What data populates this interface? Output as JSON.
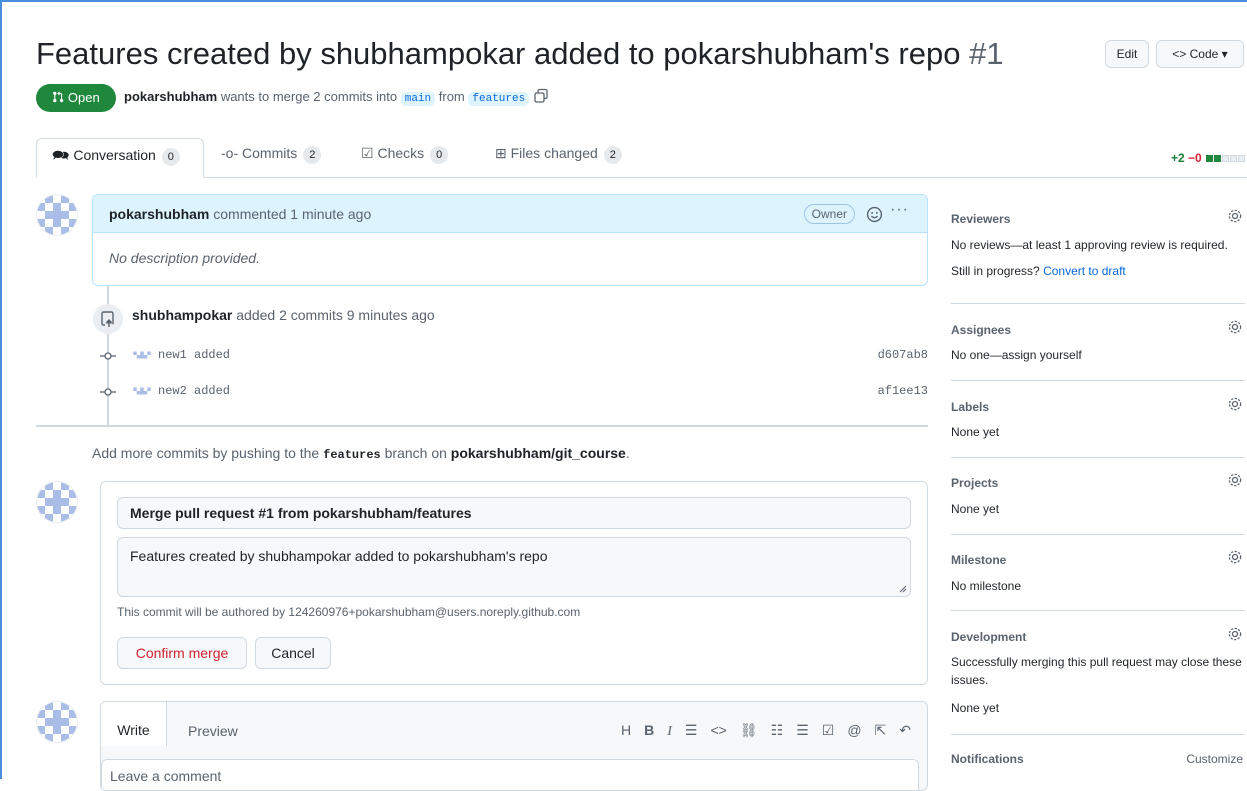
{
  "pr": {
    "title": "Features created by shubhampokar added to pokarshubham's repo",
    "number": "#1",
    "state": "Open",
    "author": "pokarshubham",
    "meta_text": "wants to merge 2 commits into",
    "base_branch": "main",
    "from_text": "from",
    "head_branch": "features"
  },
  "header_buttons": {
    "edit": "Edit",
    "code": "Code"
  },
  "tabs": [
    {
      "label": "Conversation",
      "count": "0"
    },
    {
      "label": "Commits",
      "count": "2"
    },
    {
      "label": "Checks",
      "count": "0"
    },
    {
      "label": "Files changed",
      "count": "2"
    }
  ],
  "diffstat": {
    "additions": "+2",
    "deletions": "−0"
  },
  "comment": {
    "author": "pokarshubham",
    "action": "commented 1 minute ago",
    "badge": "Owner",
    "body": "No description provided."
  },
  "event": {
    "actor": "shubhampokar",
    "action": "added 2 commits 9 minutes ago"
  },
  "commits": [
    {
      "message": "new1 added",
      "sha": "d607ab8"
    },
    {
      "message": "new2 added",
      "sha": "af1ee13"
    }
  ],
  "push_note": {
    "prefix": "Add more commits by pushing to the",
    "branch": "features",
    "middle": "branch on",
    "repo": "pokarshubham/git_course",
    "suffix": "."
  },
  "merge": {
    "title_value": "Merge pull request #1 from pokarshubham/features",
    "message_value": "Features created by shubhampokar added to pokarshubham's repo",
    "authored_note": "This commit will be authored by 124260976+pokarshubham@users.noreply.github.com",
    "confirm_label": "Confirm merge",
    "cancel_label": "Cancel"
  },
  "write": {
    "write_tab": "Write",
    "preview_tab": "Preview",
    "placeholder": "Leave a comment"
  },
  "sidebar": {
    "reviewers": {
      "title": "Reviewers",
      "text": "No reviews—at least 1 approving review is required.",
      "progress_text": "Still in progress?",
      "progress_link": "Convert to draft"
    },
    "assignees": {
      "title": "Assignees",
      "text": "No one—assign yourself"
    },
    "labels": {
      "title": "Labels",
      "text": "None yet"
    },
    "projects": {
      "title": "Projects",
      "text": "None yet"
    },
    "milestone": {
      "title": "Milestone",
      "text": "No milestone"
    },
    "development": {
      "title": "Development",
      "text": "Successfully merging this pull request may close these issues.",
      "text2": "None yet"
    },
    "notifications": {
      "title": "Notifications",
      "customize": "Customize"
    }
  },
  "colors": {
    "open_green": "#1f883d",
    "link_blue": "#0969da",
    "danger_red": "#cf222e"
  }
}
